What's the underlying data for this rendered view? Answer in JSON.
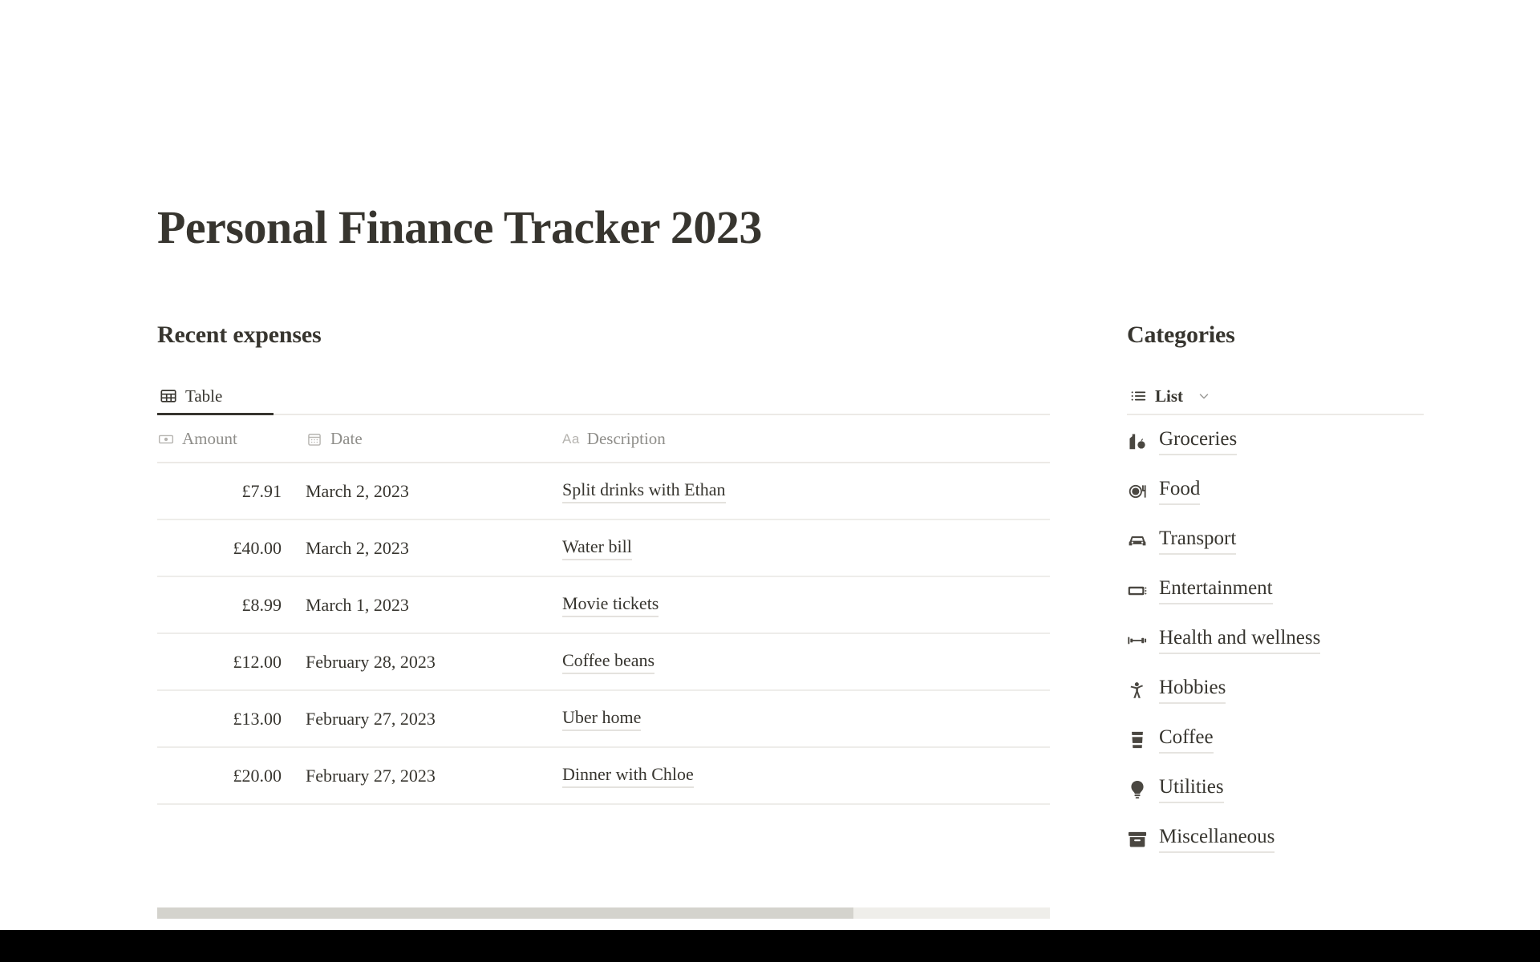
{
  "page": {
    "title": "Personal Finance Tracker 2023",
    "background_color": "#ffffff",
    "text_color": "#37352f",
    "bottom_band_color": "#000000"
  },
  "expenses": {
    "heading": "Recent expenses",
    "view_tab": {
      "label": "Table",
      "icon": "table-icon",
      "active": "true"
    },
    "columns": [
      {
        "label": "Amount",
        "icon": "banknote-icon"
      },
      {
        "label": "Date",
        "icon": "calendar-icon"
      },
      {
        "label": "Description",
        "icon": "aa-text-icon"
      }
    ],
    "rows": [
      {
        "amount": "£7.91",
        "date": "March 2, 2023",
        "description": "Split drinks with Ethan"
      },
      {
        "amount": "£40.00",
        "date": "March 2, 2023",
        "description": "Water bill"
      },
      {
        "amount": "£8.99",
        "date": "March 1, 2023",
        "description": "Movie tickets"
      },
      {
        "amount": "£12.00",
        "date": "February 28, 2023",
        "description": "Coffee beans"
      },
      {
        "amount": "£13.00",
        "date": "February 27, 2023",
        "description": "Uber home"
      },
      {
        "amount": "£20.00",
        "date": "February 27, 2023",
        "description": "Dinner with Chloe"
      }
    ],
    "scrollbar": {
      "thumb_percent": "78",
      "thumb_color": "#d4d3cd",
      "track_color": "#efeeea"
    }
  },
  "categories": {
    "heading": "Categories",
    "view_tab": {
      "label": "List",
      "icon": "list-icon",
      "chevron": "chevron-down-icon"
    },
    "items": [
      {
        "label": "Groceries",
        "icon": "groceries-icon"
      },
      {
        "label": "Food",
        "icon": "food-plate-icon"
      },
      {
        "label": "Transport",
        "icon": "car-icon"
      },
      {
        "label": "Entertainment",
        "icon": "ticket-icon"
      },
      {
        "label": "Health and wellness",
        "icon": "dumbbell-icon"
      },
      {
        "label": "Hobbies",
        "icon": "person-icon"
      },
      {
        "label": "Coffee",
        "icon": "coffee-cup-icon"
      },
      {
        "label": "Utilities",
        "icon": "lightbulb-icon"
      },
      {
        "label": "Miscellaneous",
        "icon": "archive-box-icon"
      }
    ]
  }
}
